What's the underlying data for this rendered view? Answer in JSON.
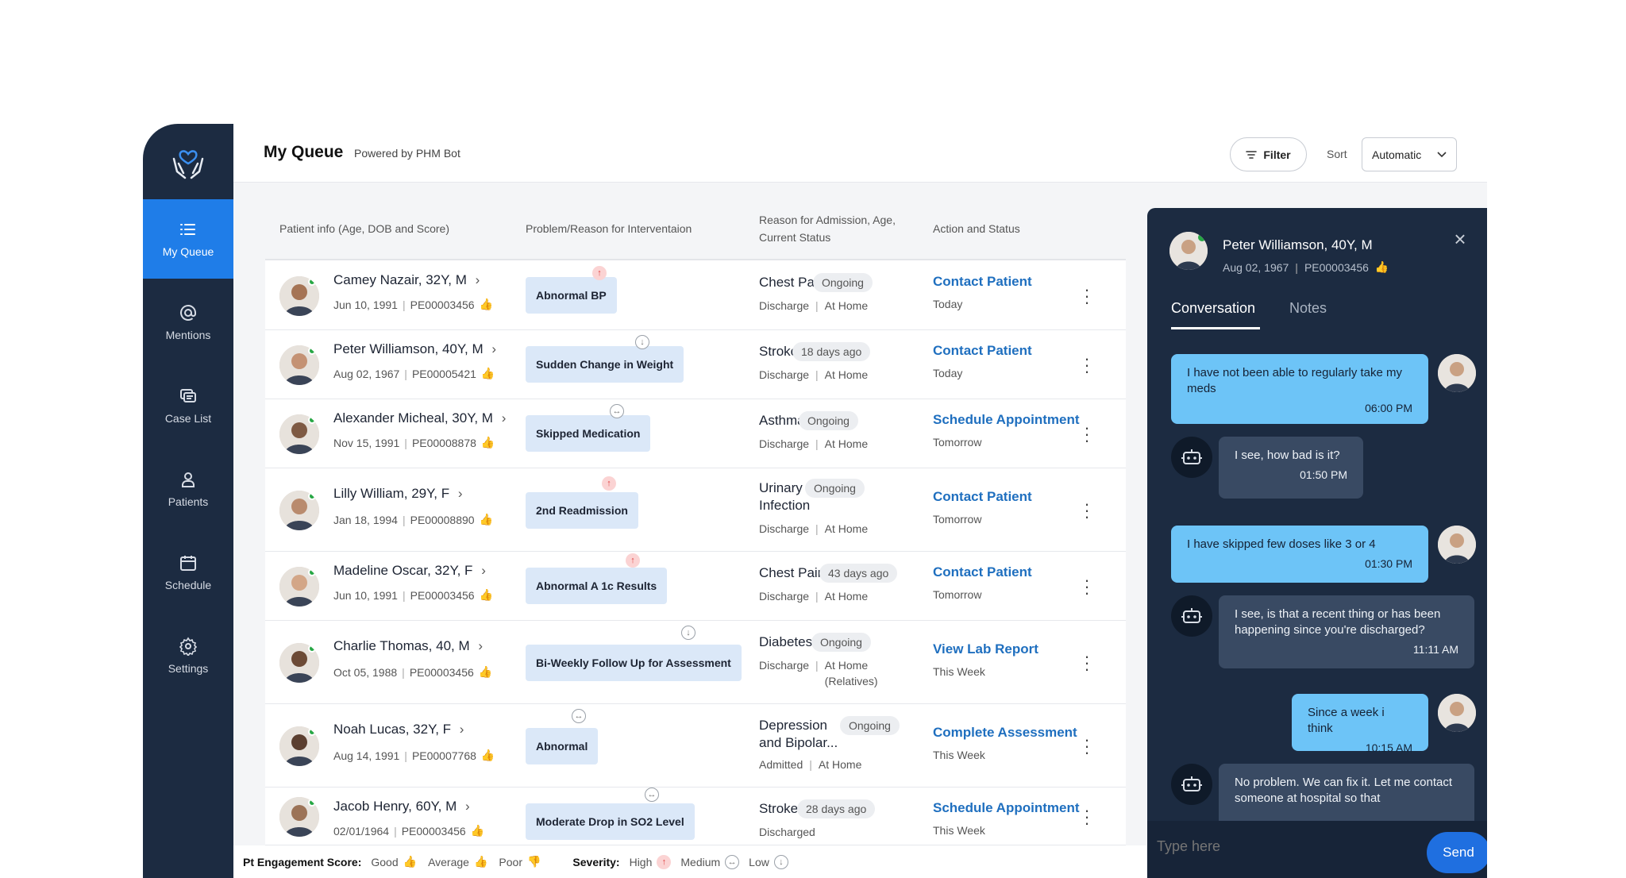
{
  "nav": {
    "items": [
      {
        "label": "My Queue",
        "icon": "list-icon"
      },
      {
        "label": "Mentions",
        "icon": "at-icon"
      },
      {
        "label": "Case List",
        "icon": "case-list-icon"
      },
      {
        "label": "Patients",
        "icon": "person-icon"
      },
      {
        "label": "Schedule",
        "icon": "calendar-icon"
      },
      {
        "label": "Settings",
        "icon": "gear-icon"
      }
    ]
  },
  "header": {
    "title": "My Queue",
    "subtitle": "Powered by PHM Bot",
    "filter_label": "Filter",
    "sort_label": "Sort",
    "sort_value": "Automatic"
  },
  "table": {
    "columns": [
      "Patient info (Age, DOB and Score)",
      "Problem/Reason for Interventaion",
      "Reason for Admission, Age, Current Status",
      "Action and Status"
    ],
    "rows": [
      {
        "name": "Camey Nazair, 32Y, M",
        "dob": "Jun 10, 1991",
        "id": "PE00003456",
        "problem": "Abnormal BP",
        "severity": "high",
        "reason": "Chest Pain",
        "pill": "Ongoing",
        "status1": "Discharge",
        "status2": "At Home",
        "action": "Contact Patient",
        "when": "Today"
      },
      {
        "name": "Peter Williamson, 40Y, M",
        "dob": "Aug 02, 1967",
        "id": "PE00005421",
        "problem": "Sudden Change in Weight",
        "severity": "low",
        "reason": "Stroke",
        "pill": "18 days ago",
        "status1": "Discharge",
        "status2": "At Home",
        "action": "Contact Patient",
        "when": "Today"
      },
      {
        "name": "Alexander Micheal, 30Y, M",
        "dob": "Nov 15, 1991",
        "id": "PE00008878",
        "problem": "Skipped Medication",
        "severity": "medium",
        "reason": "Asthma",
        "pill": "Ongoing",
        "status1": "Discharge",
        "status2": "At Home",
        "action": "Schedule Appointment",
        "when": "Tomorrow"
      },
      {
        "name": "Lilly William, 29Y, F",
        "dob": "Jan 18, 1994",
        "id": "PE00008890",
        "problem": "2nd Readmission",
        "severity": "high",
        "reason": "Urinary Infection",
        "pill": "Ongoing",
        "status1": "Discharge",
        "status2": "At Home",
        "action": "Contact Patient",
        "when": "Tomorrow"
      },
      {
        "name": "Madeline Oscar,  32Y, F",
        "dob": "Jun 10, 1991",
        "id": "PE00003456",
        "problem": "Abnormal A 1c Results",
        "severity": "high",
        "reason": "Chest Pain",
        "pill": "43 days ago",
        "status1": "Discharge",
        "status2": "At Home",
        "action": "Contact Patient",
        "when": "Tomorrow"
      },
      {
        "name": "Charlie Thomas, 40, M",
        "dob": "Oct 05, 1988",
        "id": "PE00003456",
        "problem": "Bi-Weekly Follow Up for Assessment",
        "severity": "low",
        "reason": "Diabetes",
        "pill": "Ongoing",
        "status1": "Discharge",
        "status2": "At Home (Relatives)",
        "action": "View Lab Report",
        "when": "This Week"
      },
      {
        "name": "Noah Lucas, 32Y, F",
        "dob": "Aug 14, 1991",
        "id": "PE00007768",
        "problem": "Abnormal",
        "severity": "medium",
        "reason": "Depression and Bipolar...",
        "pill": "Ongoing",
        "status1": "Admitted",
        "status2": "At Home",
        "action": "Complete Assessment",
        "when": "This Week"
      },
      {
        "name": "Jacob Henry, 60Y, M",
        "dob": "02/01/1964",
        "id": "PE00003456",
        "problem": "Moderate Drop in SO2 Level",
        "severity": "medium",
        "reason": "Stroke",
        "pill": "28 days ago",
        "status1": "Discharged",
        "status2": "",
        "action": "Schedule Appointment",
        "when": "This Week"
      }
    ]
  },
  "legend": {
    "engagement_label": "Pt Engagement Score:",
    "good": "Good",
    "average": "Average",
    "poor": "Poor",
    "severity_label": "Severity:",
    "high": "High",
    "medium": "Medium",
    "low": "Low"
  },
  "chat": {
    "patient_name": "Peter Williamson, 40Y, M",
    "patient_dob": "Aug 02, 1967",
    "patient_id": "PE00003456",
    "tabs": [
      "Conversation",
      "Notes"
    ],
    "messages": [
      {
        "from": "user",
        "text": "I have not been able to regularly take my meds",
        "time": "06:00 PM"
      },
      {
        "from": "bot",
        "text": "I see, how bad is it?",
        "time": "01:50 PM"
      },
      {
        "from": "user",
        "text": "I have skipped few doses like 3 or 4",
        "time": "01:30 PM"
      },
      {
        "from": "bot",
        "text": "I see, is that a recent thing or has been happening since you're discharged?",
        "time": "11:11 AM"
      },
      {
        "from": "user",
        "text": "Since a week i think",
        "time": "10:15 AM"
      },
      {
        "from": "bot",
        "text": "No problem. We can fix it. Let me contact someone at hospital so that",
        "time": ""
      }
    ],
    "input_placeholder": "Type here",
    "send_label": "Send"
  },
  "colors": {
    "accent": "#1f7de8",
    "sidebar": "#1c2b41",
    "link": "#1f6fbf",
    "user_bubble": "#6dc4f7",
    "good": "#2e9a44",
    "average": "#e6a318",
    "poor": "#e0313b",
    "high": "#e04343"
  }
}
